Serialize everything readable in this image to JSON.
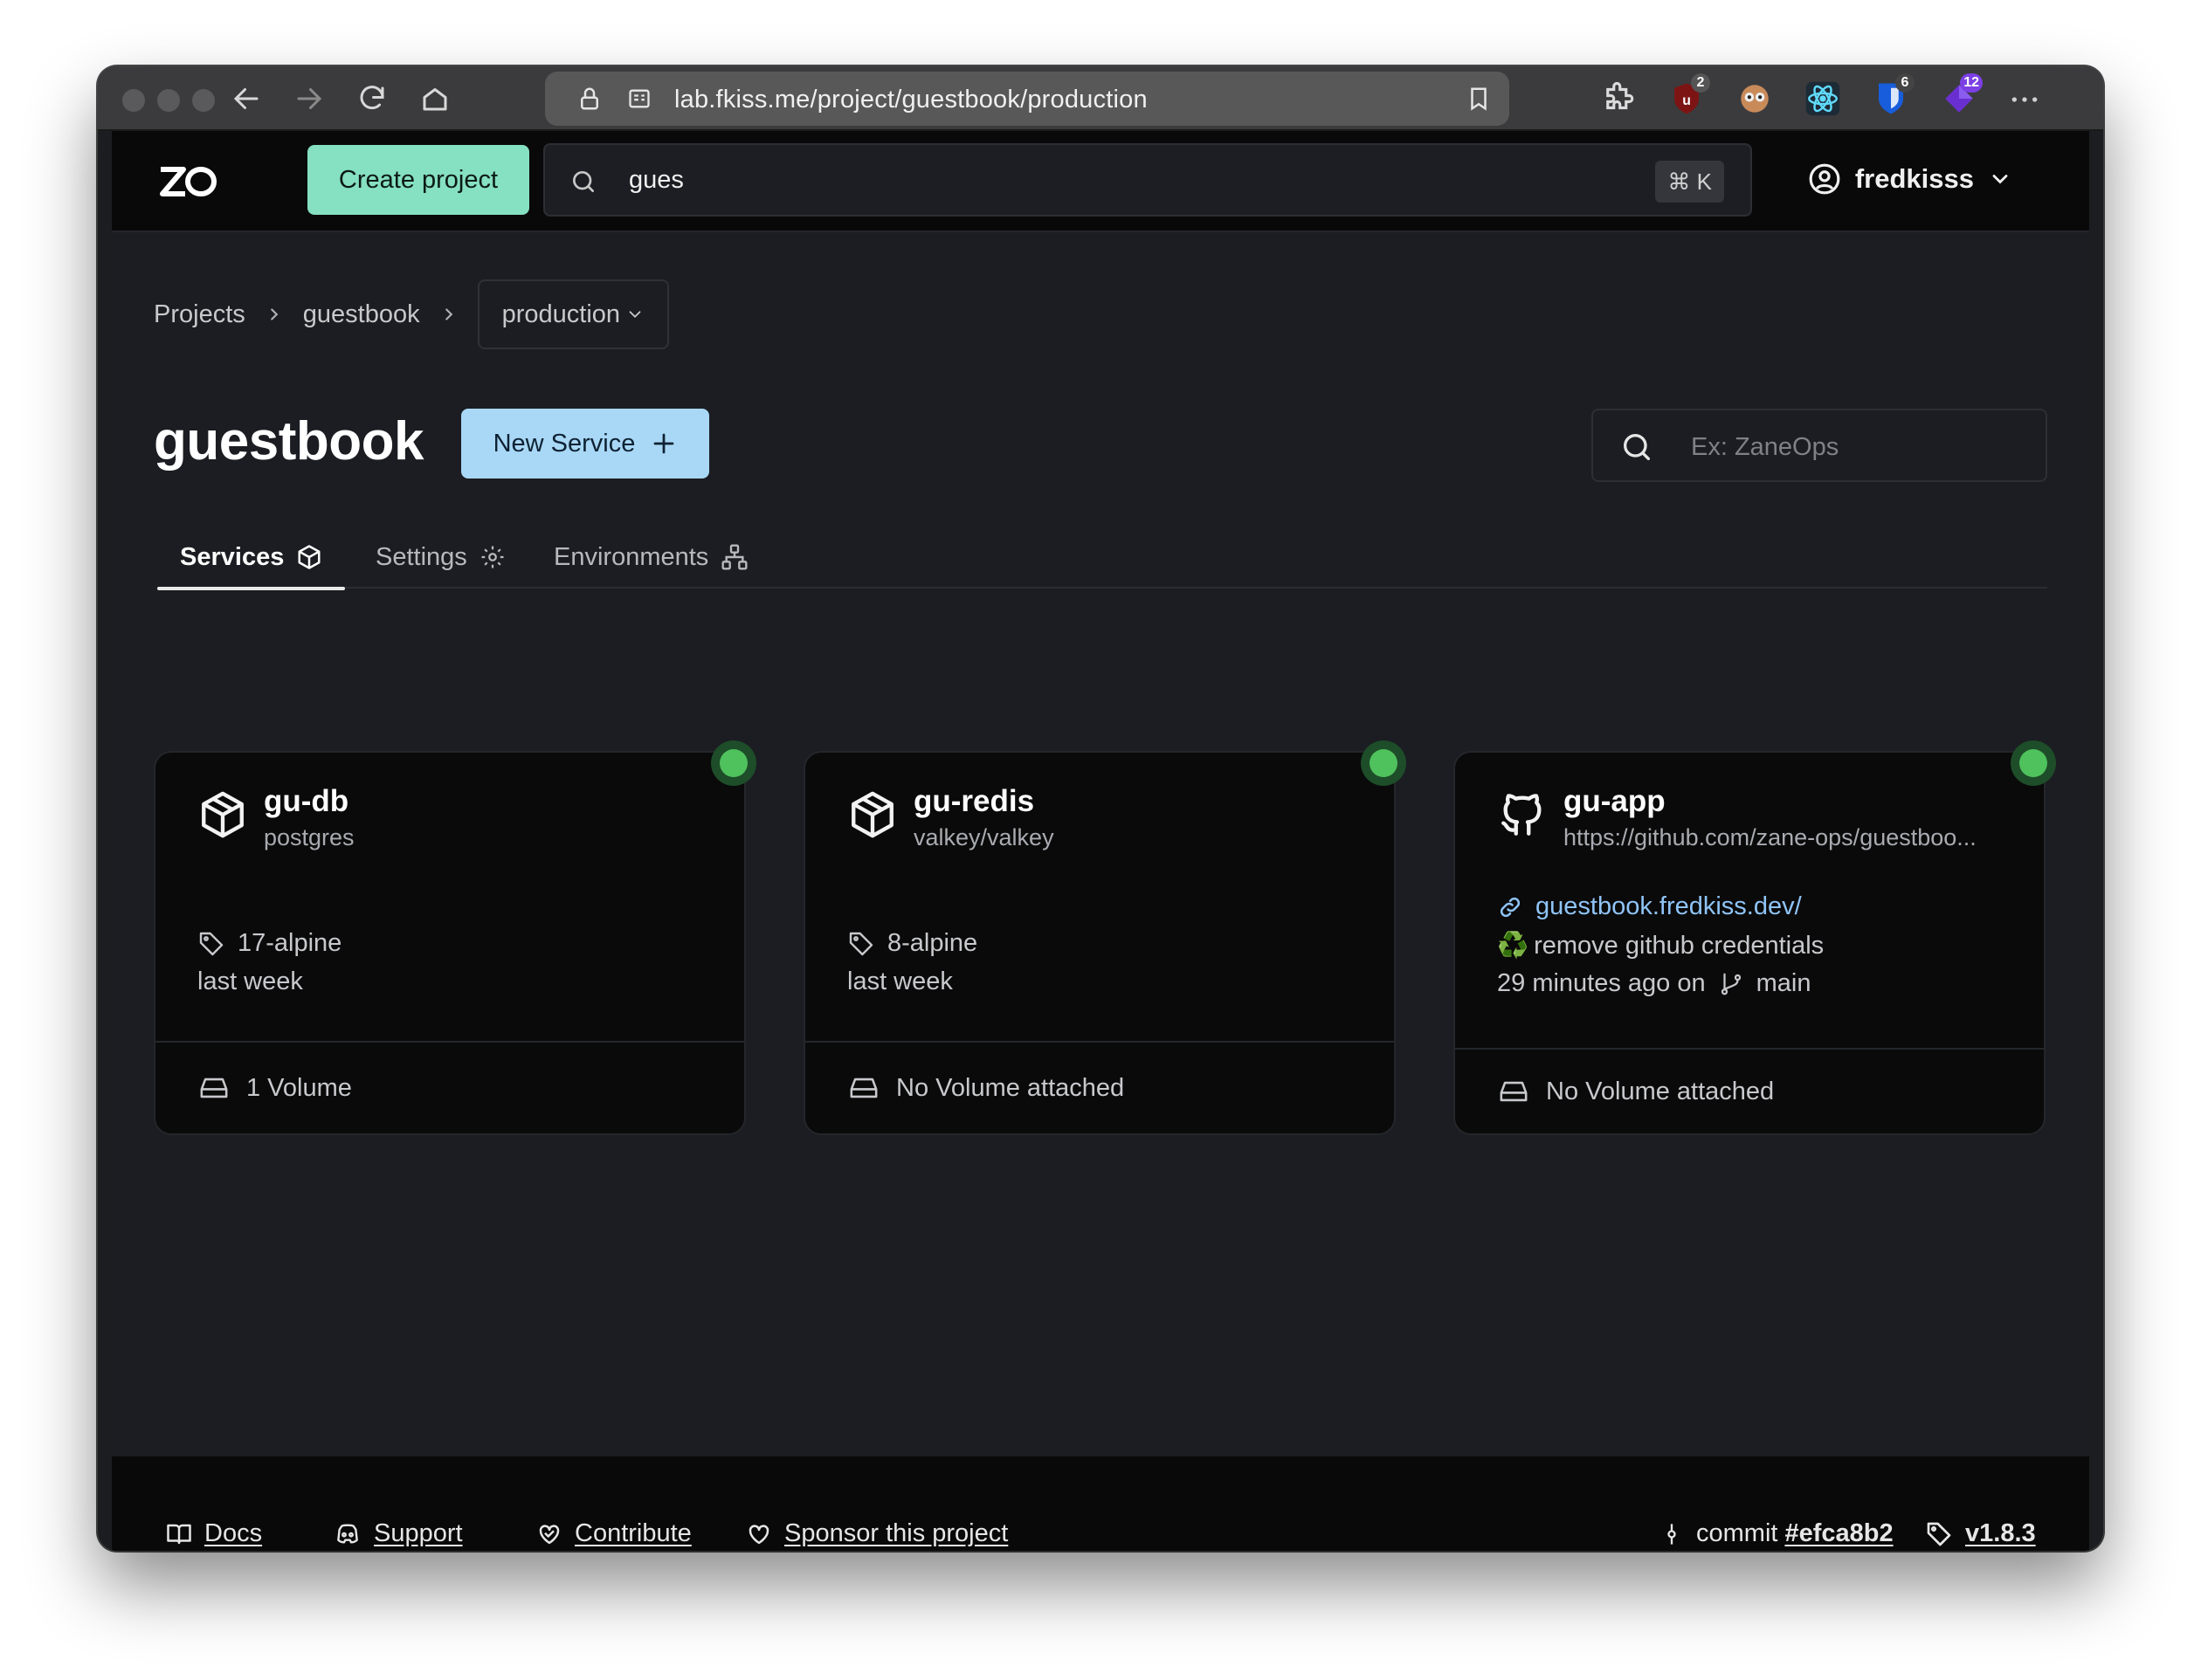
{
  "browser": {
    "url": "lab.fkiss.me/project/guestbook/production",
    "extensions": [
      {
        "icon": "puzzle-icon",
        "badge": ""
      },
      {
        "icon": "ublock-icon",
        "badge": "2"
      },
      {
        "icon": "owl-icon",
        "badge": ""
      },
      {
        "icon": "react-icon",
        "badge": ""
      },
      {
        "icon": "bitwarden-icon",
        "badge": "6"
      },
      {
        "icon": "gem-icon",
        "badge": "12"
      }
    ]
  },
  "header": {
    "logo": "ZO",
    "create_label": "Create project",
    "search_value": "gues",
    "shortcut": "⌘ K",
    "username": "fredkisss"
  },
  "breadcrumb": {
    "projects": "Projects",
    "project": "guestbook",
    "environment": "production"
  },
  "page": {
    "title": "guestbook",
    "new_service_label": "New Service",
    "filter_placeholder": "Ex: ZaneOps"
  },
  "tabs": [
    {
      "label": "Services",
      "icon": "box-icon",
      "active": true
    },
    {
      "label": "Settings",
      "icon": "gear-icon",
      "active": false
    },
    {
      "label": "Environments",
      "icon": "network-icon",
      "active": false
    }
  ],
  "services": [
    {
      "name": "gu-db",
      "image": "postgres",
      "tag": "17-alpine",
      "updated": "last week",
      "volume": "1 Volume",
      "status": "healthy",
      "status_color": "#4fc15d"
    },
    {
      "name": "gu-redis",
      "image": "valkey/valkey",
      "tag": "8-alpine",
      "updated": "last week",
      "volume": "No Volume attached",
      "status": "healthy",
      "status_color": "#4fc15d"
    },
    {
      "name": "gu-app",
      "repo": "https://github.com/zane-ops/guestboo...",
      "url": "guestbook.fredkiss.dev/",
      "commit_emoji": "♻️",
      "commit_message": "remove github credentials",
      "updated": "29 minutes ago on",
      "branch": "main",
      "volume": "No Volume attached",
      "status": "healthy",
      "status_color": "#4fc15d"
    }
  ],
  "footer": {
    "docs": "Docs",
    "support": "Support",
    "contribute": "Contribute",
    "sponsor": "Sponsor this project",
    "commit_prefix": "commit",
    "commit_hash": "#efca8b2",
    "version": "v1.8.3"
  },
  "colors": {
    "accent_green": "#86e0c2",
    "accent_blue": "#a9d8f6",
    "link": "#8fc4f7",
    "status_ok": "#4fc15d"
  }
}
